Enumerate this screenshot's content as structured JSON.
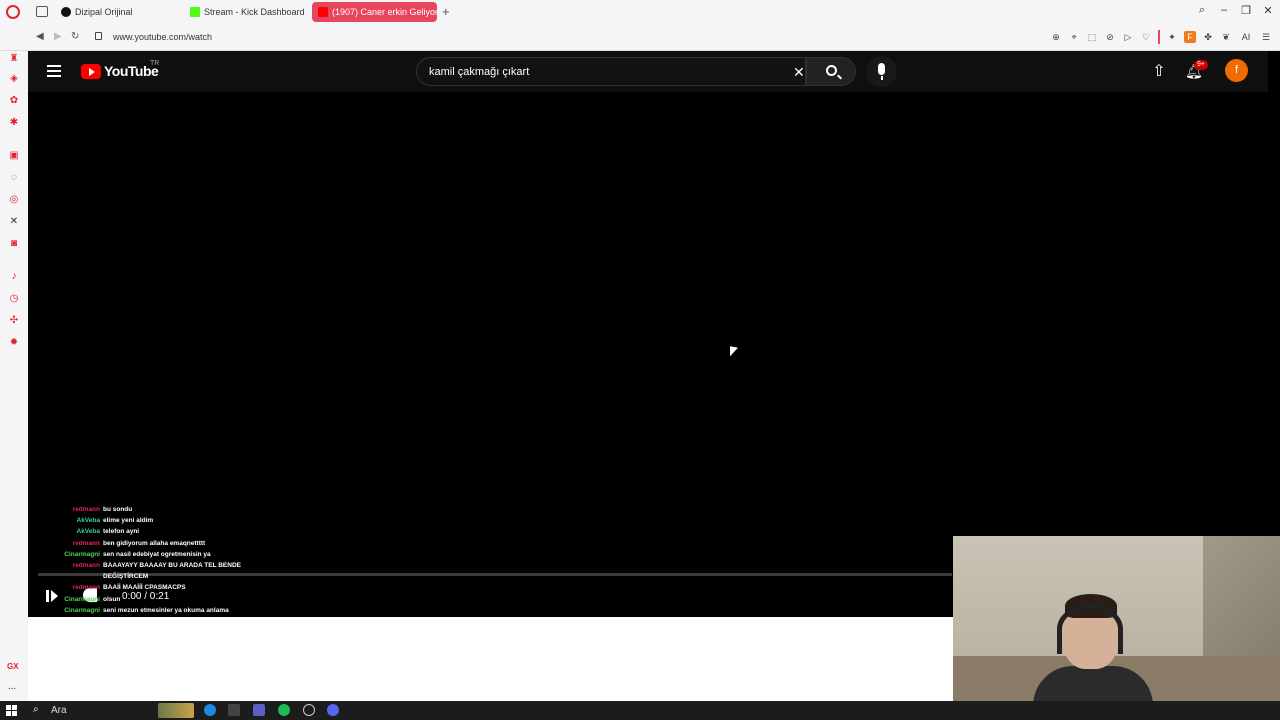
{
  "browser": {
    "tabs": [
      {
        "label": "Dizipal Orijinal",
        "active": false
      },
      {
        "label": "Stream - Kick Dashboard",
        "active": false
      },
      {
        "label": "(1907) Caner erkin Geliyor",
        "active": true
      }
    ],
    "new_tab_label": "+",
    "url": "www.youtube.com/watch",
    "extensions_label_ai": "AI",
    "extension_f": "F",
    "sidebar_gx": "GX",
    "sidebar_more": "..."
  },
  "youtube": {
    "logo_text": "YouTube",
    "region": "TR",
    "search_value": "kamil çakmağı çıkart",
    "notification_badge": "9+",
    "avatar_letter": "f"
  },
  "player": {
    "time": "0:00 / 0:21",
    "progress": 0
  },
  "chat": [
    {
      "user": "redmann",
      "msg": "bu sondu",
      "color": "red",
      "faded": false
    },
    {
      "user": "AkVeba",
      "msg": "elime yeni aldim",
      "color": "teal",
      "faded": false
    },
    {
      "user": "AkVeba",
      "msg": "telefon ayni",
      "color": "teal",
      "faded": false
    },
    {
      "user": "redmann",
      "msg": "ben gidiyorum allaha emaqnettttt",
      "color": "red",
      "faded": false
    },
    {
      "user": "Cinarmagni",
      "msg": "sen nasil edebiyat ogretmenisin ya",
      "color": "green",
      "faded": false
    },
    {
      "user": "redmann",
      "msg": "BAAAYAYY BAAAAY BU ARADA TEL BENDE",
      "color": "red",
      "faded": false
    },
    {
      "user": "",
      "msg": "DEĞİŞTİRCEM",
      "color": "red",
      "faded": false
    },
    {
      "user": "redmann",
      "msg": "BAAİİ MAAİİİ CPASMACPS",
      "color": "red",
      "faded": false
    },
    {
      "user": "Cinarmagni",
      "msg": "olsun",
      "color": "green",
      "faded": false
    },
    {
      "user": "Cinarmagni",
      "msg": "seni mezun etmesinler ya okuma anlama",
      "color": "green",
      "faded": false
    }
  ],
  "taskbar": {
    "search_label": "Ara"
  },
  "colors": {
    "opera_red": "#e0242f",
    "yt_red": "#ff0000",
    "active_tab": "#e8455e",
    "avatar": "#ef6c00"
  }
}
